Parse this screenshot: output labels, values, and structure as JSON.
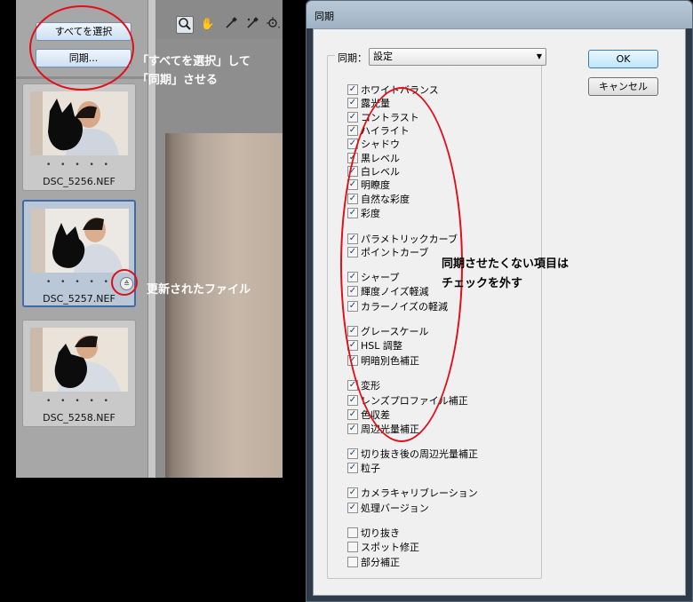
{
  "left_panel": {
    "select_all_label": "すべてを選択",
    "sync_label": "同期...",
    "thumbnails": [
      {
        "name": "DSC_5256.NEF",
        "rating_dots": "• • • • •"
      },
      {
        "name": "DSC_5257.NEF",
        "rating_dots": "• • • • •"
      },
      {
        "name": "DSC_5258.NEF",
        "rating_dots": "• • • • •"
      }
    ],
    "update_badge_icon": "≙",
    "tools": [
      "zoom-icon",
      "hand-icon",
      "white-balance-icon",
      "color-sampler-icon",
      "target-adjust-icon"
    ]
  },
  "annotations": {
    "select_sync_line1": "「すべてを選択」して",
    "select_sync_line2": "「同期」させる",
    "updated_file": "更新されたファイル",
    "uncheck_line1": "同期させたくない項目は",
    "uncheck_line2": "チェックを外す",
    "annotation_color": "#e0101a"
  },
  "dialog": {
    "title": "同期",
    "preset_label": "同期：",
    "preset_value": "設定",
    "ok_label": "OK",
    "cancel_label": "キャンセル",
    "items": [
      {
        "label": "ホワイトバランス",
        "checked": true
      },
      {
        "label": "露光量",
        "checked": true
      },
      {
        "label": "コントラスト",
        "checked": true
      },
      {
        "label": "ハイライト",
        "checked": true
      },
      {
        "label": "シャドウ",
        "checked": true
      },
      {
        "label": "黒レベル",
        "checked": true
      },
      {
        "label": "白レベル",
        "checked": true
      },
      {
        "label": "明瞭度",
        "checked": true
      },
      {
        "label": "自然な彩度",
        "checked": true
      },
      {
        "label": "彩度",
        "checked": true
      },
      {
        "label": "パラメトリックカーブ",
        "checked": true
      },
      {
        "label": "ポイントカーブ",
        "checked": true
      },
      {
        "label": "シャープ",
        "checked": true
      },
      {
        "label": "輝度ノイズ軽減",
        "checked": true
      },
      {
        "label": "カラーノイズの軽減",
        "checked": true
      },
      {
        "label": "グレースケール",
        "checked": true
      },
      {
        "label": "HSL 調整",
        "checked": true
      },
      {
        "label": "明暗別色補正",
        "checked": true
      },
      {
        "label": "変形",
        "checked": true
      },
      {
        "label": "レンズプロファイル補正",
        "checked": true
      },
      {
        "label": "色収差",
        "checked": true
      },
      {
        "label": "周辺光量補正",
        "checked": true
      },
      {
        "label": "切り抜き後の周辺光量補正",
        "checked": true
      },
      {
        "label": "粒子",
        "checked": true
      },
      {
        "label": "カメラキャリブレーション",
        "checked": true
      },
      {
        "label": "処理バージョン",
        "checked": true
      },
      {
        "label": "切り抜き",
        "checked": false
      },
      {
        "label": "スポット修正",
        "checked": false
      },
      {
        "label": "部分補正",
        "checked": false
      }
    ]
  }
}
